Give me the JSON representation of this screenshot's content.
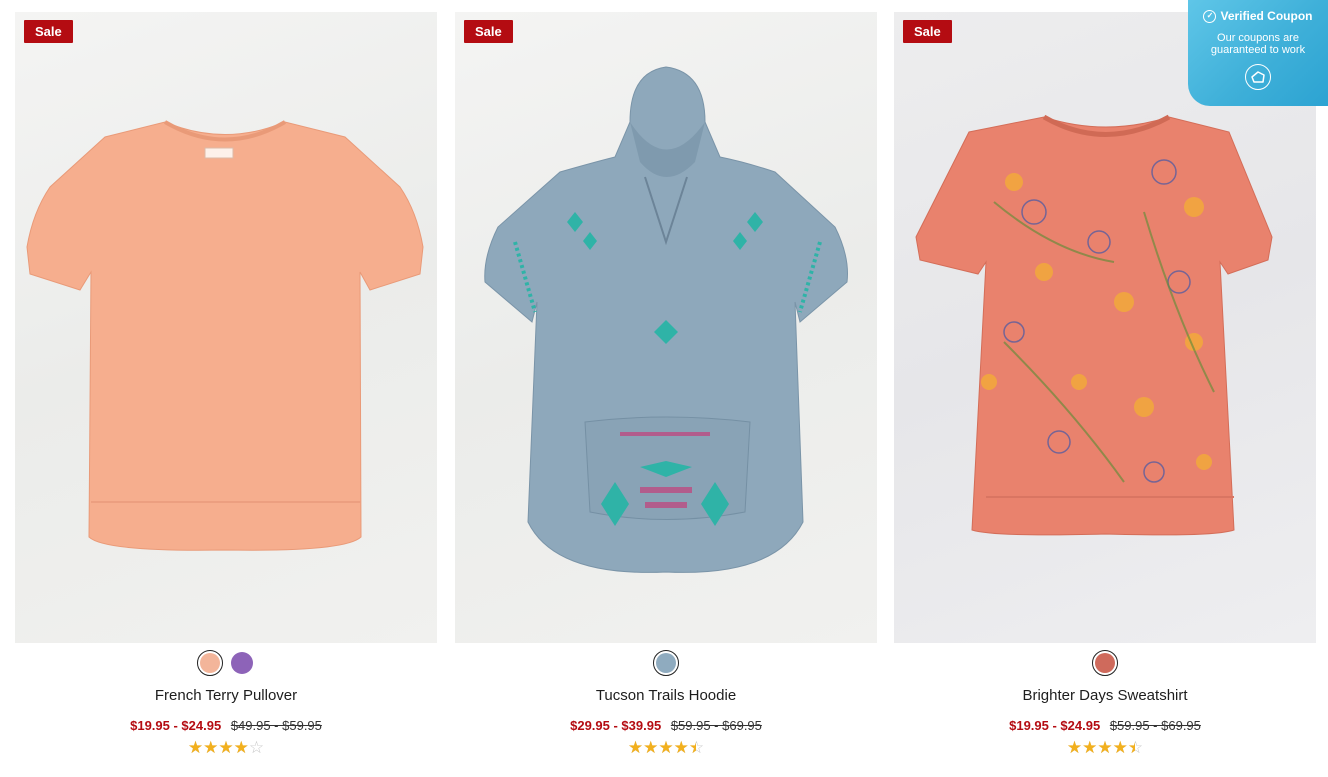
{
  "products": [
    {
      "name": "French Terry Pullover",
      "badge": "Sale",
      "sale_price": "$19.95 - $24.95",
      "original_price": "$49.95 - $59.95",
      "rating": 4,
      "rating_max": 5,
      "colors": [
        "#f3b59a",
        "#8d63b8"
      ],
      "selected_color": 0,
      "garment_color": "#f6ae8e"
    },
    {
      "name": "Tucson Trails Hoodie",
      "badge": "Sale",
      "sale_price": "$29.95 - $39.95",
      "original_price": "$59.95 - $69.95",
      "rating": 4.5,
      "rating_max": 5,
      "colors": [
        "#8fabbf"
      ],
      "selected_color": 0,
      "garment_color": "#8ea8bb"
    },
    {
      "name": "Brighter Days Sweatshirt",
      "badge": "Sale",
      "sale_price": "$19.95 - $24.95",
      "original_price": "$59.95 - $69.95",
      "rating": 4.5,
      "rating_max": 5,
      "colors": [
        "#cf6a5c"
      ],
      "selected_color": 0,
      "garment_color": "#e9826d"
    }
  ],
  "coupon": {
    "title": "Verified Coupon",
    "subtitle": "Our coupons are guaranteed to work",
    "icon": "check-circle-icon",
    "logo_icon": "coupon-logo-icon"
  },
  "colors": {
    "sale_red": "#b40c12",
    "star_gold": "#f2b01e",
    "coupon_blue": "#3fb0d9"
  }
}
